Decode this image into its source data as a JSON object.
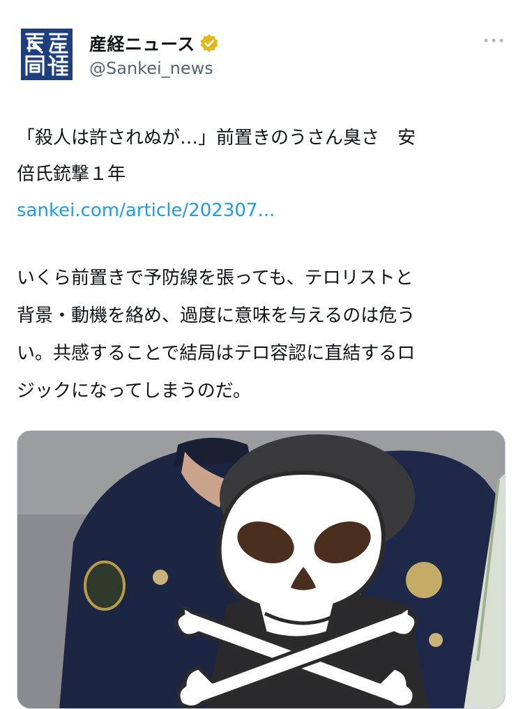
{
  "header": {
    "display_name": "産経ニュース",
    "handle": "@Sankei_news",
    "logo_text": "産經新聞"
  },
  "tweet": {
    "headline_line1": "「殺人は許されぬが…」前置きのうさん臭さ　安",
    "headline_line2": "倍氏銃撃１年",
    "link": "sankei.com/article/202307...",
    "body_lines": [
      "いくら前置きで予防線を張っても、テロリストと",
      "背景・動機を絡め、過度に意味を与えるのは危う",
      "い。共感することで結局はテロ容認に直結するロ",
      "ジックになってしまうのだ。"
    ]
  },
  "colors": {
    "link": "#1d9bf0",
    "verified_badge": "#e2b719",
    "logo_bg": "#1d3f7f"
  },
  "icons": {
    "verified": "verified-badge-icon",
    "more": "more-options-icon",
    "media_overlay": "skull-crossbones-sticker"
  }
}
